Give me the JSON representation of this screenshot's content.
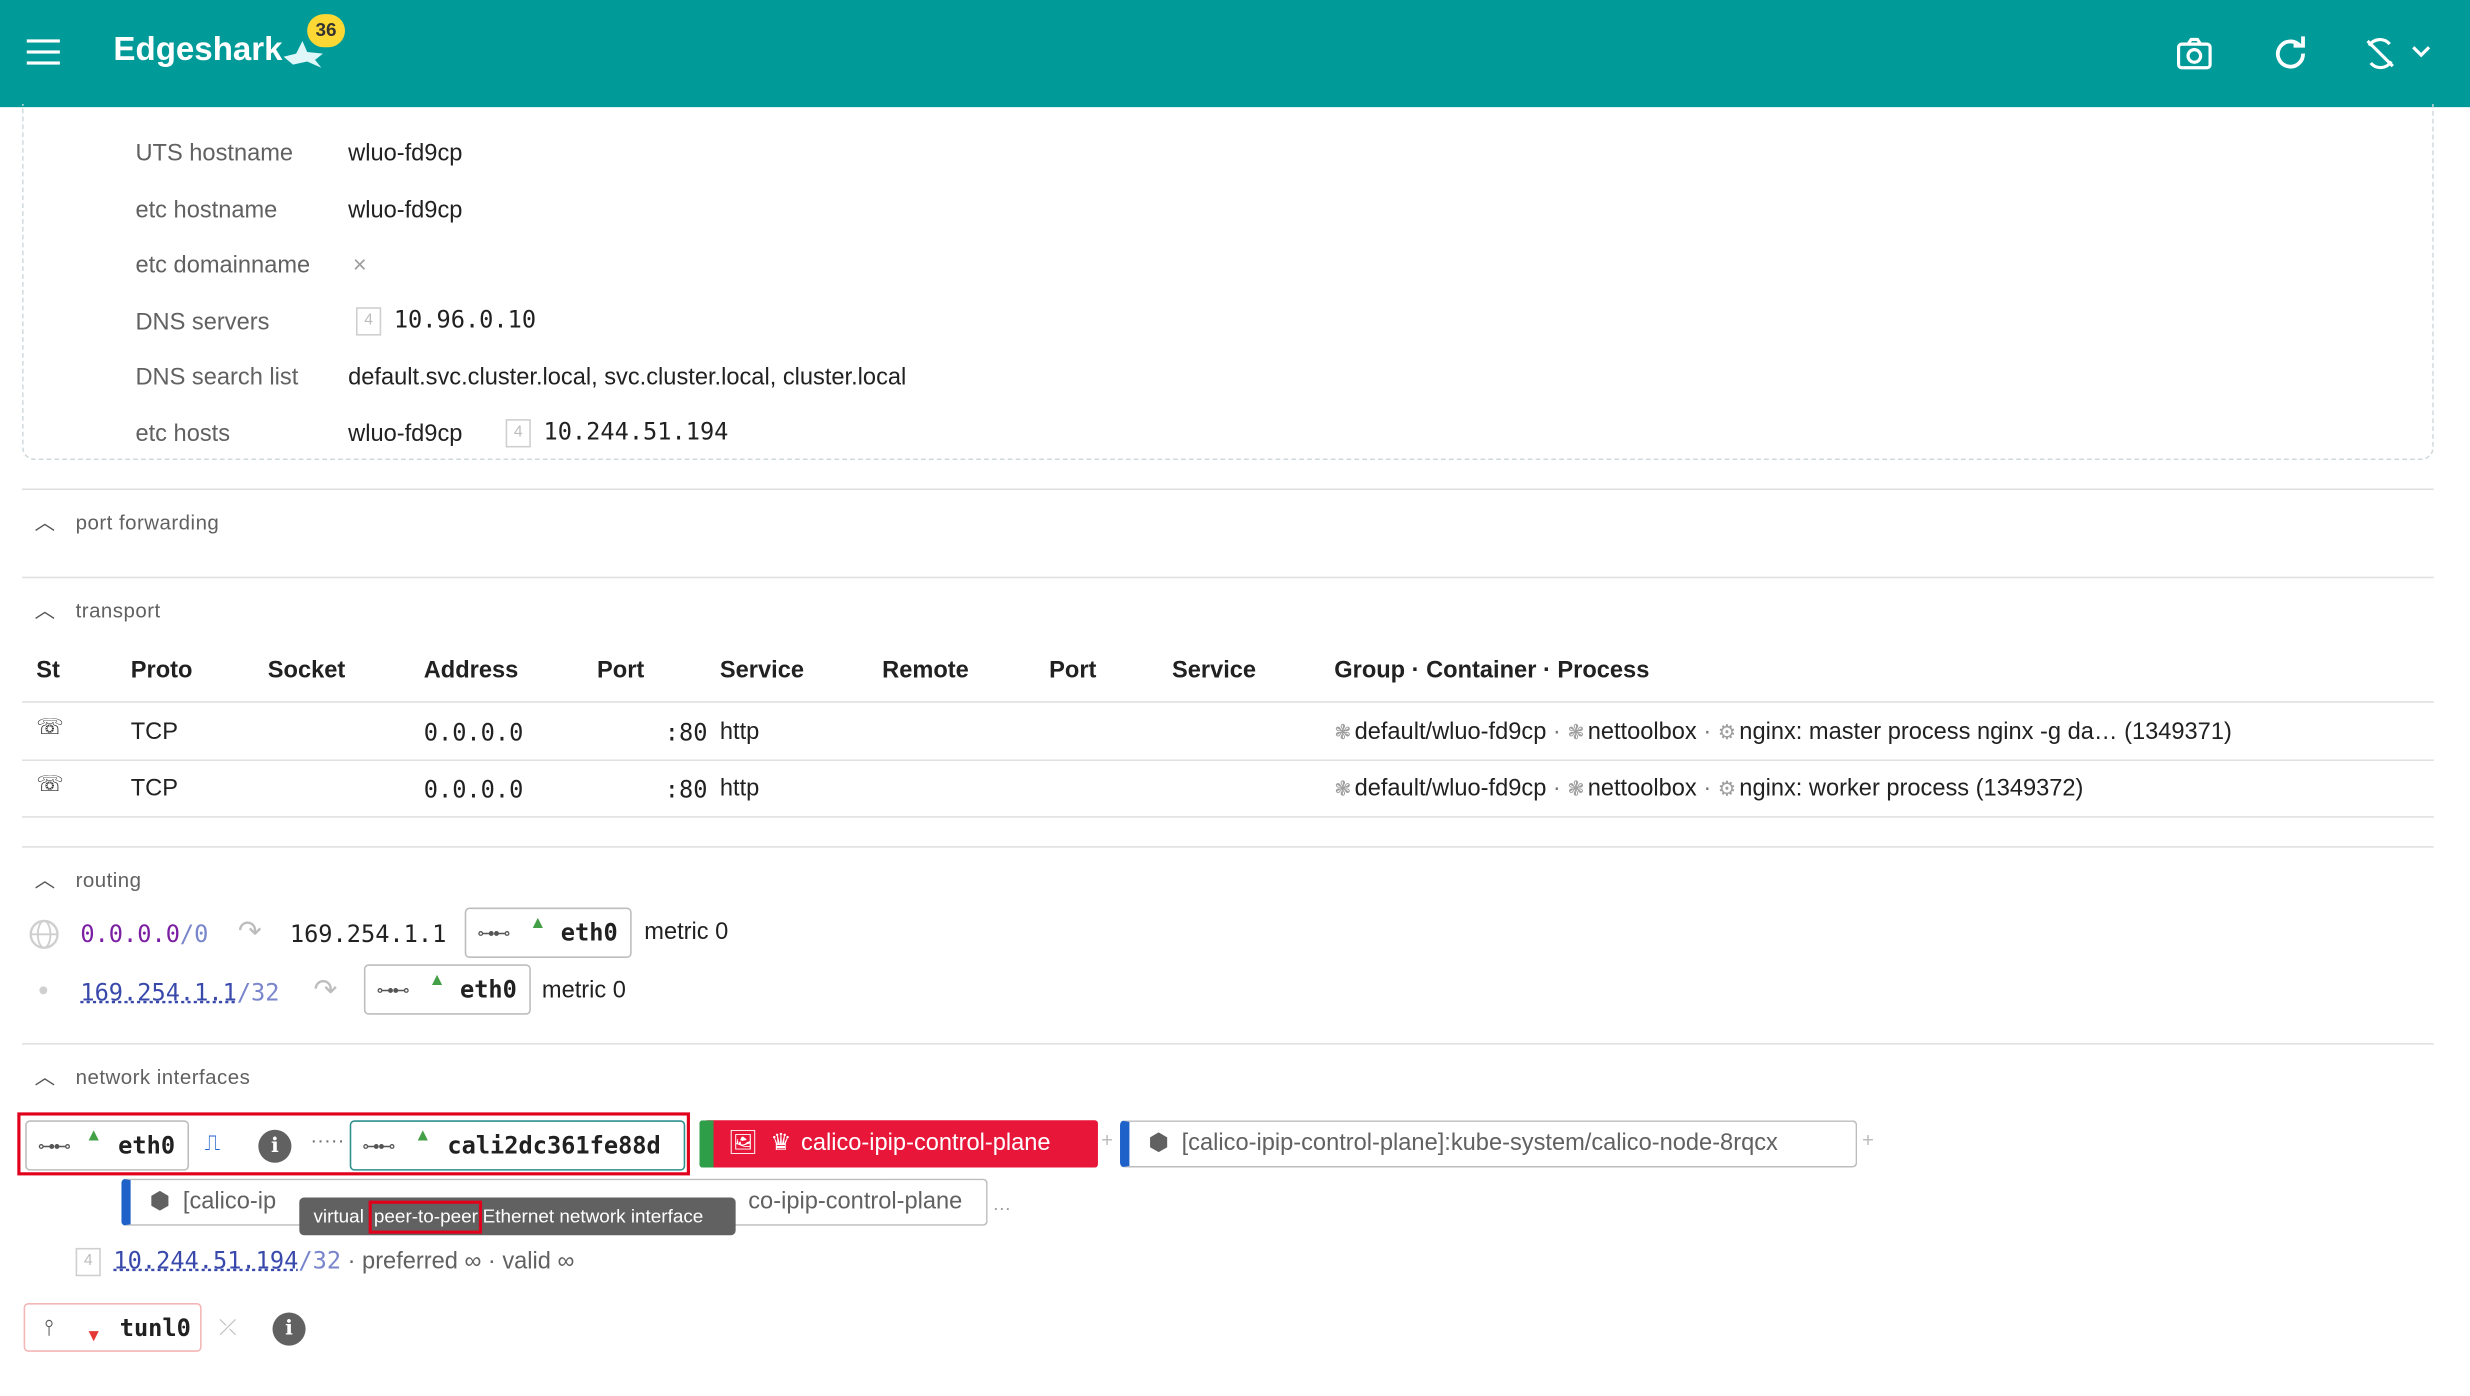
{
  "app": {
    "title": "Edgeshark",
    "badge_count": "36"
  },
  "toolbar": {
    "menu_icon": "menu-icon",
    "camera_icon": "camera-icon",
    "refresh_icon": "refresh-icon",
    "sync_icon": "sync-off-icon",
    "dropdown_icon": "chevron-down-icon"
  },
  "details": {
    "uts_hostname_label": "UTS hostname",
    "uts_hostname": "wluo-fd9cp",
    "etc_hostname_label": "etc hostname",
    "etc_hostname": "wluo-fd9cp",
    "etc_domainname_label": "etc domainname",
    "etc_domainname": "×",
    "dns_servers_label": "DNS servers",
    "dns_server": "10.96.0.10",
    "dns_search_label": "DNS search list",
    "dns_search": "default.svc.cluster.local, svc.cluster.local, cluster.local",
    "etc_hosts_label": "etc hosts",
    "etc_hosts_name": "wluo-fd9cp",
    "etc_hosts_ip": "10.244.51.194",
    "ipv4_tag": "4"
  },
  "sections": {
    "port_forwarding": "port forwarding",
    "transport": "transport",
    "routing": "routing",
    "network_interfaces": "network interfaces"
  },
  "transport": {
    "headers": [
      "St",
      "Proto",
      "Socket",
      "Address",
      "Port",
      "Service",
      "Remote",
      "Port",
      "Service",
      "Group · Container · Process"
    ],
    "rows": [
      {
        "proto": "TCP",
        "address": "0.0.0.0",
        "port": ":80",
        "service": "http",
        "group": "default/wluo-fd9cp",
        "container": "nettoolbox",
        "process": "nginx: master process nginx -g da… (1349371)"
      },
      {
        "proto": "TCP",
        "address": "0.0.0.0",
        "port": ":80",
        "service": "http",
        "group": "default/wluo-fd9cp",
        "container": "nettoolbox",
        "process": "nginx: worker process (1349372)"
      }
    ]
  },
  "routing": {
    "routes": [
      {
        "dest": "0.0.0.0",
        "prefix": "/0",
        "gateway": "169.254.1.1",
        "iface": "eth0",
        "metric": "metric 0"
      },
      {
        "dest": "169.254.1.1",
        "prefix": "/32",
        "iface": "eth0",
        "metric": "metric 0"
      }
    ]
  },
  "interfaces": {
    "eth0": "eth0",
    "peer": "cali2dc361fe88d",
    "cp_label": "calico-ipip-control-plane",
    "container1": "[calico-ipip-control-plane]:kube-system/calico-node-8rqcx",
    "container2_left": "[calico-ip",
    "container2_right": "co-ipip-control-plane",
    "tooltip_pre": "virtual",
    "tooltip_highlight": "peer-to-peer",
    "tooltip_post": "Ethernet network interface",
    "addr": "10.244.51.194",
    "addr_prefix": "/32",
    "addr_lifetimes": "· preferred ∞ · valid ∞",
    "tunl0": "tunl0",
    "dots": "·····",
    "plus": "+",
    "ellipsis": "…"
  },
  "colors": {
    "appbar": "#009a98",
    "badge": "#fdd835",
    "highlight": "#e0001b",
    "container_blue": "#1e62c9",
    "cp_red": "#e8173a",
    "cp_green": "#2e9e49",
    "up_green": "#43a047"
  }
}
